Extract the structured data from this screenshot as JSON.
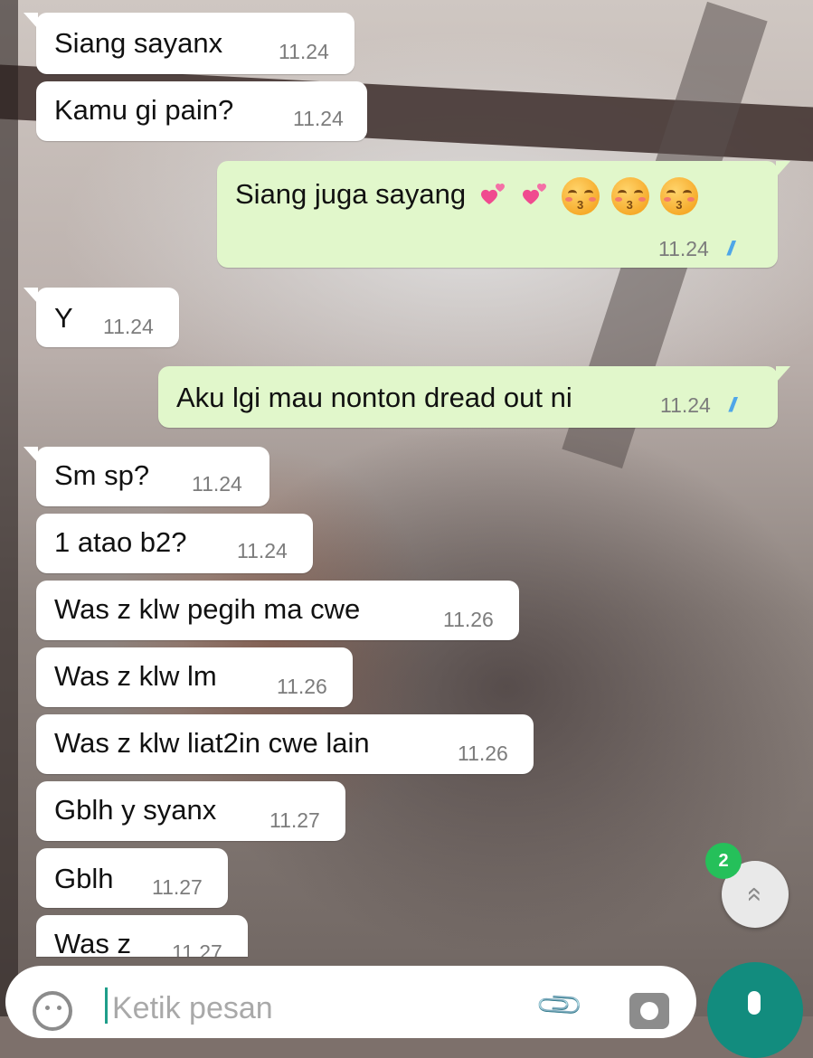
{
  "messages": [
    {
      "dir": "in",
      "text": "Siang sayanx",
      "time": "11.24"
    },
    {
      "dir": "in",
      "text": "Kamu gi pain?",
      "time": "11.24"
    },
    {
      "dir": "out",
      "text": "Siang juga sayang",
      "emoji": [
        "two-hearts",
        "two-hearts",
        "kissing-face",
        "kissing-face",
        "kissing-face"
      ],
      "time": "11.24",
      "status": "read"
    },
    {
      "dir": "in",
      "text": "Y",
      "time": "11.24"
    },
    {
      "dir": "out",
      "text": "Aku lgi mau nonton dread out ni",
      "time": "11.24",
      "status": "read"
    },
    {
      "dir": "in",
      "text": "Sm sp?",
      "time": "11.24"
    },
    {
      "dir": "in",
      "text": "1 atao b2?",
      "time": "11.24"
    },
    {
      "dir": "in",
      "text": "Was z klw pegih ma cwe",
      "time": "11.26"
    },
    {
      "dir": "in",
      "text": "Was z klw lm",
      "time": "11.26"
    },
    {
      "dir": "in",
      "text": "Was z klw liat2in cwe lain",
      "time": "11.26"
    },
    {
      "dir": "in",
      "text": "Gblh y syanx",
      "time": "11.27"
    },
    {
      "dir": "in",
      "text": "Gblh",
      "time": "11.27"
    },
    {
      "dir": "in",
      "text": "Was z",
      "time": "11.27"
    }
  ],
  "scroll_button": {
    "unread_count": "2",
    "icon": "double-chevron-down-icon"
  },
  "composer": {
    "placeholder": "Ketik pesan",
    "emoji_icon": "emoji-icon",
    "attach_icon": "paperclip-icon",
    "camera_icon": "camera-icon"
  },
  "mic_icon": "microphone-icon",
  "colors": {
    "incoming": "#ffffff",
    "outgoing": "#e1f7cb",
    "read_ticks": "#4fa6e8",
    "accent": "#128c7e",
    "badge": "#25c05a"
  }
}
